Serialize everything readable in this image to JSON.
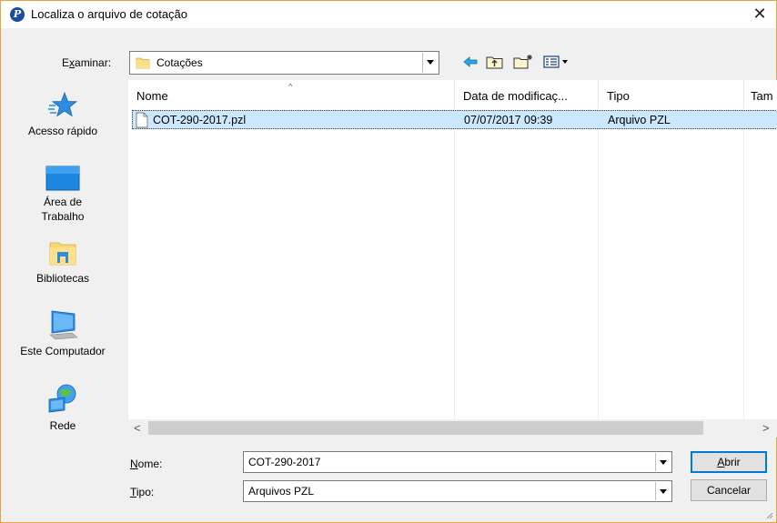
{
  "window": {
    "title": "Localiza o arquivo de cotação",
    "close_glyph": "✕",
    "accent": "#0078d7"
  },
  "toolbar": {
    "look_in_label": "Examinar:",
    "look_in_value": "Cotações",
    "tools": [
      "back-arrow-icon",
      "up-folder-icon",
      "new-folder-icon",
      "view-menu-icon"
    ]
  },
  "places": [
    {
      "label": "Acesso rápido",
      "icon": "star-icon"
    },
    {
      "label": "Área de Trabalho",
      "icon": "desktop-icon"
    },
    {
      "label": "Bibliotecas",
      "icon": "libraries-icon"
    },
    {
      "label": "Este Computador",
      "icon": "computer-icon"
    },
    {
      "label": "Rede",
      "icon": "network-icon"
    }
  ],
  "file_list": {
    "columns": [
      "Nome",
      "Data de modificaç...",
      "Tipo",
      "Tam"
    ],
    "rows": [
      {
        "name": "COT-290-2017.pzl",
        "modified": "07/07/2017 09:39",
        "type": "Arquivo PZL",
        "selected": true
      }
    ]
  },
  "scrollbar": {
    "left_glyph": "<",
    "right_glyph": ">"
  },
  "form": {
    "name_label": "Nome:",
    "name_value": "COT-290-2017",
    "type_label": "Tipo:",
    "type_value": "Arquivos PZL",
    "open_label": "Abrir",
    "cancel_label": "Cancelar"
  }
}
